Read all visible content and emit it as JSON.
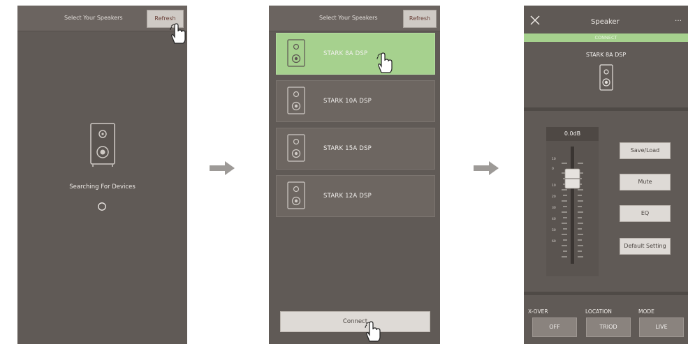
{
  "screen1": {
    "title": "Select Your Speakers",
    "refresh_label": "Refresh",
    "status": "Searching For Devices"
  },
  "screen2": {
    "title": "Select Your Speakers",
    "refresh_label": "Refresh",
    "speakers": [
      {
        "label": "STARK 8A DSP",
        "selected": true
      },
      {
        "label": "STARK 10A DSP",
        "selected": false
      },
      {
        "label": "STARK 15A DSP",
        "selected": false
      },
      {
        "label": "STARK 12A DSP",
        "selected": false
      }
    ],
    "connect_label": "Connect"
  },
  "screen3": {
    "close_icon": "close-icon",
    "title": "Speaker",
    "more_label": "…",
    "connect_status": "CONNECT",
    "device_name": "STARK 8A DSP",
    "fader": {
      "gain": "0.0dB",
      "scale": [
        "10",
        "0",
        "10",
        "20",
        "30",
        "40",
        "50",
        "60"
      ]
    },
    "buttons": {
      "save_load": "Save/Load",
      "mute": "Mute",
      "eq": "EQ",
      "default": "Default Setting"
    },
    "bottom": {
      "xover_label": "X-OVER",
      "xover_value": "OFF",
      "location_label": "LOCATION",
      "location_value": "TRIOD",
      "mode_label": "MODE",
      "mode_value": "LIVE"
    }
  },
  "colors": {
    "screen_bg": "#605a56",
    "accent_green": "#a6d18e",
    "arrow": "#9d9a97"
  }
}
